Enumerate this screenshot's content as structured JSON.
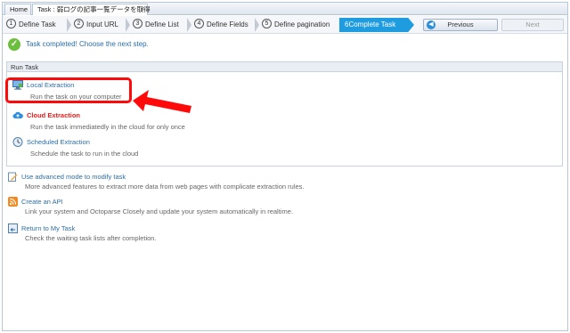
{
  "tabs": [
    {
      "label": "Home"
    },
    {
      "label": "Task : 弱ログの記事一覧データを取得",
      "close": "×"
    }
  ],
  "steps": [
    {
      "num": "1",
      "label": "Define Task"
    },
    {
      "num": "2",
      "label": "Input URL"
    },
    {
      "num": "3",
      "label": "Define List"
    },
    {
      "num": "4",
      "label": "Define Fields"
    },
    {
      "num": "5",
      "label": "Define pagination"
    },
    {
      "num": "6",
      "label": "Complete Task"
    }
  ],
  "nav": {
    "previous": "Previous",
    "next": "Next"
  },
  "status": {
    "message": "Task completed! Choose the next step."
  },
  "run_panel": {
    "header": "Run Task",
    "options": [
      {
        "title": "Local Extraction",
        "desc": "Run the task on your computer",
        "icon": "computer-icon"
      },
      {
        "title": "Cloud Extraction",
        "desc": "Run the task immediatedly in the cloud for only once",
        "icon": "cloud-icon"
      },
      {
        "title": "Scheduled Extraction",
        "desc": "Schedule the task to run in the cloud",
        "icon": "clock-icon"
      }
    ]
  },
  "links": [
    {
      "title": "Use advanced mode to modify task",
      "desc": "More advanced features to extract more data from web pages with complicate extraction rules.",
      "icon": "edit-icon"
    },
    {
      "title": "Create an API",
      "desc": "Link your system and Octoparse Closely and update your system automatically in realtime.",
      "icon": "rss-icon"
    },
    {
      "title": "Return to My Task",
      "desc": "Check the waiting task lists after completion.",
      "icon": "return-icon"
    }
  ],
  "colors": {
    "accent": "#1f9ce0",
    "highlight": "#ff0a0a",
    "link": "#2b6ea8",
    "success": "#6cbf3c"
  }
}
